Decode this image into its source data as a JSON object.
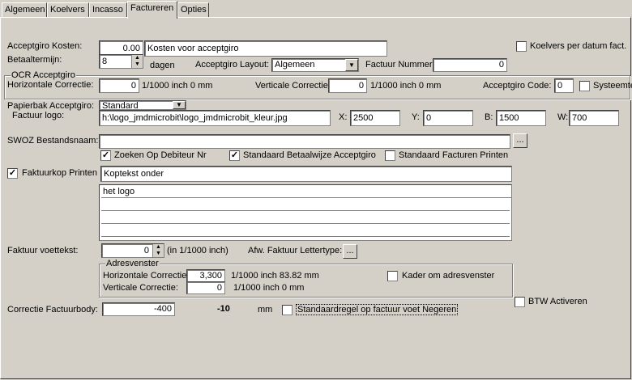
{
  "tabs": [
    "Algemeen",
    "Koelvers",
    "Incasso",
    "Factureren",
    "Opties"
  ],
  "acceptgiro_kosten": {
    "label": "Acceptgiro Kosten:",
    "value": "0.00",
    "desc": "Kosten voor acceptgiro"
  },
  "koelvers_per_datum": {
    "label": "Koelvers per datum fact.",
    "checked": false
  },
  "betaaltermijn": {
    "label": "Betaaltermijn:",
    "value": "8",
    "unit": "dagen"
  },
  "acceptgiro_layout": {
    "label": "Acceptgiro Layout:",
    "value": "Algemeen"
  },
  "factuur_nummer": {
    "label": "Factuur Nummer:",
    "value": "0"
  },
  "ocr": {
    "legend": "OCR Acceptgiro",
    "hor_label": "Horizontale Correctie:",
    "hor_value": "0",
    "hor_unit": "1/1000 inch 0 mm",
    "vert_label": "Verticale Correctie:",
    "vert_value": "0",
    "vert_unit": "1/1000 inch 0 mm",
    "code_label": "Acceptgiro Code:",
    "code_value": "0",
    "systeem_label": "Systeemte"
  },
  "papierbak": {
    "label": "Papierbak Acceptgiro:",
    "value": "Standard"
  },
  "factuur_logo": {
    "label": "Factuur logo:",
    "path": "h:\\logo_jmdmicrobit\\logo_jmdmicrobit_kleur.jpg",
    "x_label": "X:",
    "x": "2500",
    "y_label": "Y:",
    "y": "0",
    "b_label": "B:",
    "b": "1500",
    "w_label": "W:",
    "w": "700"
  },
  "swoz": {
    "label": "SWOZ Bestandsnaam:",
    "value": "",
    "browse": "..."
  },
  "checks": {
    "zoeken": {
      "label": "Zoeken Op Debiteur Nr",
      "checked": true
    },
    "standaard_betaalwijze": {
      "label": "Standaard Betaalwijze Acceptgiro",
      "checked": true
    },
    "standaard_facturen": {
      "label": "Standaard Facturen Printen",
      "checked": false
    }
  },
  "faktuurkop": {
    "label": "Faktuurkop Printen",
    "checked": true,
    "koptekst": "Koptekst onder",
    "lines": [
      "het logo",
      "",
      "",
      "",
      ""
    ]
  },
  "voettekst": {
    "label": "Faktuur voettekst:",
    "value": "0",
    "unit": "(in 1/1000 inch)",
    "font_label": "Afw. Faktuur Lettertype:",
    "font_btn": "..."
  },
  "adresvenster": {
    "legend": "Adresvenster",
    "hor_label": "Horizontale Correctie:",
    "hor_value": "3,300",
    "hor_unit": "1/1000 inch 83.82 mm",
    "vert_label": "Verticale Correctie:",
    "vert_value": "0",
    "vert_unit": "1/1000 inch 0 mm",
    "kader_label": "Kader om adresvenster",
    "kader_checked": false
  },
  "btw": {
    "label": "BTW Activeren",
    "checked": false
  },
  "correctie": {
    "label": "Correctie Factuurbody:",
    "value": "-400",
    "display": "-10",
    "unit": "mm",
    "negeren_label": "Standaardregel op factuur voet Negeren",
    "negeren_checked": false
  },
  "colors": {
    "face": "#d4d0c8",
    "field": "#ffffff",
    "shadow": "#808080"
  }
}
